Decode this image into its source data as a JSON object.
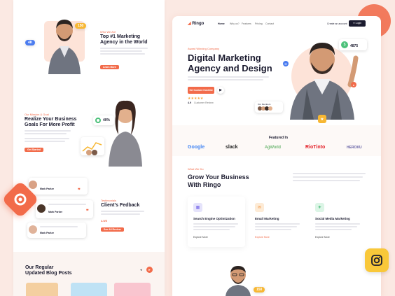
{
  "left_page": {
    "hero": {
      "eyebrow": "Who We Are",
      "title_line1": "Top #1 Marketing",
      "title_line2": "Agency in the World",
      "button": "Learn More",
      "badge_left": "4K",
      "badge_right": "150"
    },
    "profit": {
      "eyebrow": "Our Mission & Goal",
      "title_line1": "Realize Your Business",
      "title_line2": "Goals For More Profit",
      "button": "Get Started",
      "stat_value": "40%"
    },
    "feedback": {
      "eyebrow": "Testimonials",
      "title": "Client's Fedback",
      "stat": "4.9/5",
      "button": "See All Review",
      "reviews": [
        {
          "name": "Mark Parker"
        },
        {
          "name": "Mark Parker"
        },
        {
          "name": "Mark Parker"
        }
      ]
    },
    "blog": {
      "title_line1": "Our Regular",
      "title_line2": "Updated Blog Posts"
    }
  },
  "site": {
    "logo": "Ringo",
    "nav": [
      "Home",
      "Why us?",
      "Features",
      "Pricing",
      "Contact"
    ],
    "create_account": "Create an account",
    "login": "Login",
    "hero": {
      "eyebrow": "Award Winning Company",
      "title_line1": "Digital Marketing",
      "title_line2": "Agency and Design",
      "cta": "Get Custom Checklist",
      "rating_count": "4.9",
      "rating_text": "Customer Review",
      "stat_value": "4875",
      "team_label": "Our Members"
    },
    "featured": {
      "title": "Featured In",
      "logos": [
        "Google",
        "slack",
        "AgWorld",
        "RioTinto",
        "HEROKU"
      ]
    },
    "grow": {
      "eyebrow": "What We Do",
      "title_line1": "Grow Your Business",
      "title_line2": "With Ringo"
    },
    "services": [
      {
        "title": "Search Engine Optimization",
        "link": "Explore More"
      },
      {
        "title": "Email Marketing",
        "link": "Explore More"
      },
      {
        "title": "Social Media Marketing",
        "link": "Explore More"
      }
    ],
    "bottom_badge": "150"
  },
  "colors": {
    "accent": "#f26b4a",
    "background": "#fbe9e3",
    "dark": "#1b1b2f",
    "instagram_bg": "#f9c83a"
  },
  "icons": [
    "logo-badge-icon",
    "instagram-icon",
    "play-icon",
    "arrow-icon"
  ]
}
